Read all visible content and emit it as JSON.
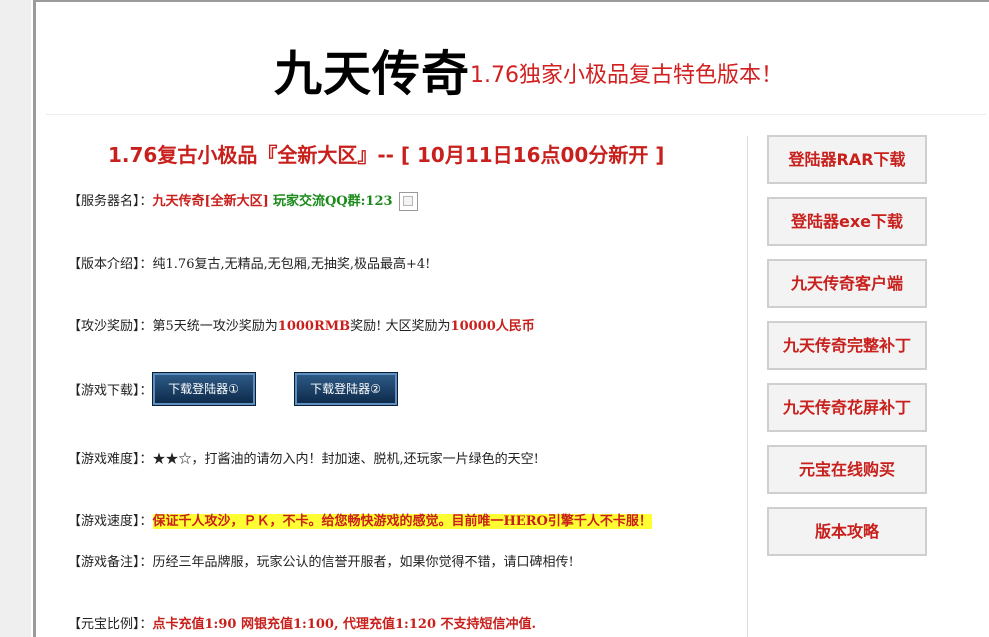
{
  "header": {
    "brand": "九天传奇",
    "tagline": "1.76独家小极品复古特色版本！"
  },
  "main": {
    "headline": "1.76复古小极品『全新大区』-- [ 10月11日16点00分新开 ]",
    "server": {
      "label": "【服务器名】：",
      "name": "九天传奇[全新大区]",
      "qq": "玩家交流QQ群:123"
    },
    "version": {
      "label": "【版本介绍】：",
      "text": "纯1.76复古,无精品,无包厢,无抽奖,极品最高+4!"
    },
    "siege": {
      "label": "【攻沙奖励】：",
      "text1": "第5天统一攻沙奖励为",
      "value1": "1000RMB",
      "text2": "奖励!  大区奖励为",
      "value2": "10000人民币"
    },
    "download": {
      "label": "【游戏下载】：",
      "btn1": "下载登陆器①",
      "btn2": "下载登陆器②"
    },
    "difficulty": {
      "label": "【游戏难度】：",
      "stars": "★★☆",
      "text": "，打酱油的请勿入内！封加速、脱机,还玩家一片绿色的天空!"
    },
    "speed": {
      "label": "【游戏速度】：",
      "text": "保证千人攻沙，ＰＫ，不卡。给您畅快游戏的感觉。目前唯一HERO引擎千人不卡服！"
    },
    "notes": {
      "label": "【游戏备注】：",
      "text": "历经三年品牌服，玩家公认的信誉开服者，如果你觉得不错，请口碑相传!"
    },
    "ratio": {
      "label": "【元宝比例】：",
      "text": "点卡充值1:90  网银充值1:100, 代理充值1:120  不支持短信冲值."
    }
  },
  "sidebar": {
    "items": [
      {
        "label": "登陆器RAR下载"
      },
      {
        "label": "登陆器exe下载"
      },
      {
        "label": "九天传奇客户端"
      },
      {
        "label": "九天传奇完整补丁"
      },
      {
        "label": "九天传奇花屏补丁"
      },
      {
        "label": "元宝在线购买"
      },
      {
        "label": "版本攻略"
      }
    ]
  },
  "colors": {
    "accent_red": "#c8201c",
    "green": "#1a8a1a",
    "highlight": "#ffff33"
  },
  "icons": {
    "broken_image": "broken-image-icon"
  }
}
